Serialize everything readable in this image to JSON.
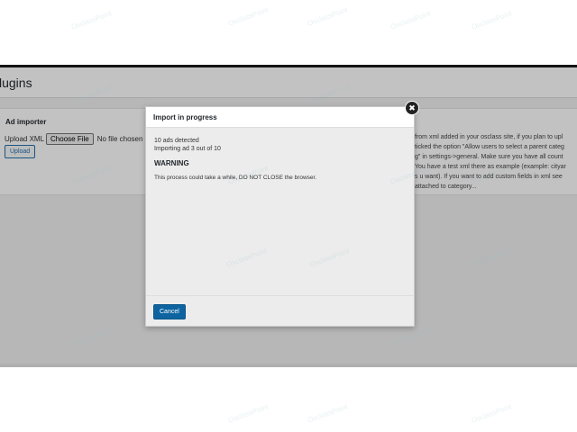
{
  "page": {
    "title": "lugins"
  },
  "importer": {
    "heading": "Ad importer",
    "upload_label": "Upload XML",
    "choose_file_label": "Choose File",
    "no_file_label": "No file chosen",
    "upload_button": "Upload",
    "description_lines": [
      "from xml added in your osclass site, if you plan to upl",
      "ticked the option \"Allow users to select a parent categ",
      "g\" in settings->general. Make sure you have all count",
      "You have a test xml there as example (example: cityar",
      "s u want). If you want to add custom fields in xml see",
      "attached to category..."
    ]
  },
  "modal": {
    "title": "Import in progress",
    "ads_detected": "10 ads detected",
    "progress_text": "Importing ad 3 out of 10",
    "progress": {
      "current": 3,
      "total": 10
    },
    "warning_title": "WARNING",
    "warning_text": "This process could take a while, DO NOT CLOSE the browser.",
    "cancel_label": "Cancel",
    "close_glyph": "✖"
  },
  "watermark": {
    "text": "OsclassPoint"
  },
  "colors": {
    "primary_button": "#0e64a0",
    "link": "#2271b1",
    "overlay": "rgba(0,0,0,0.24)"
  }
}
